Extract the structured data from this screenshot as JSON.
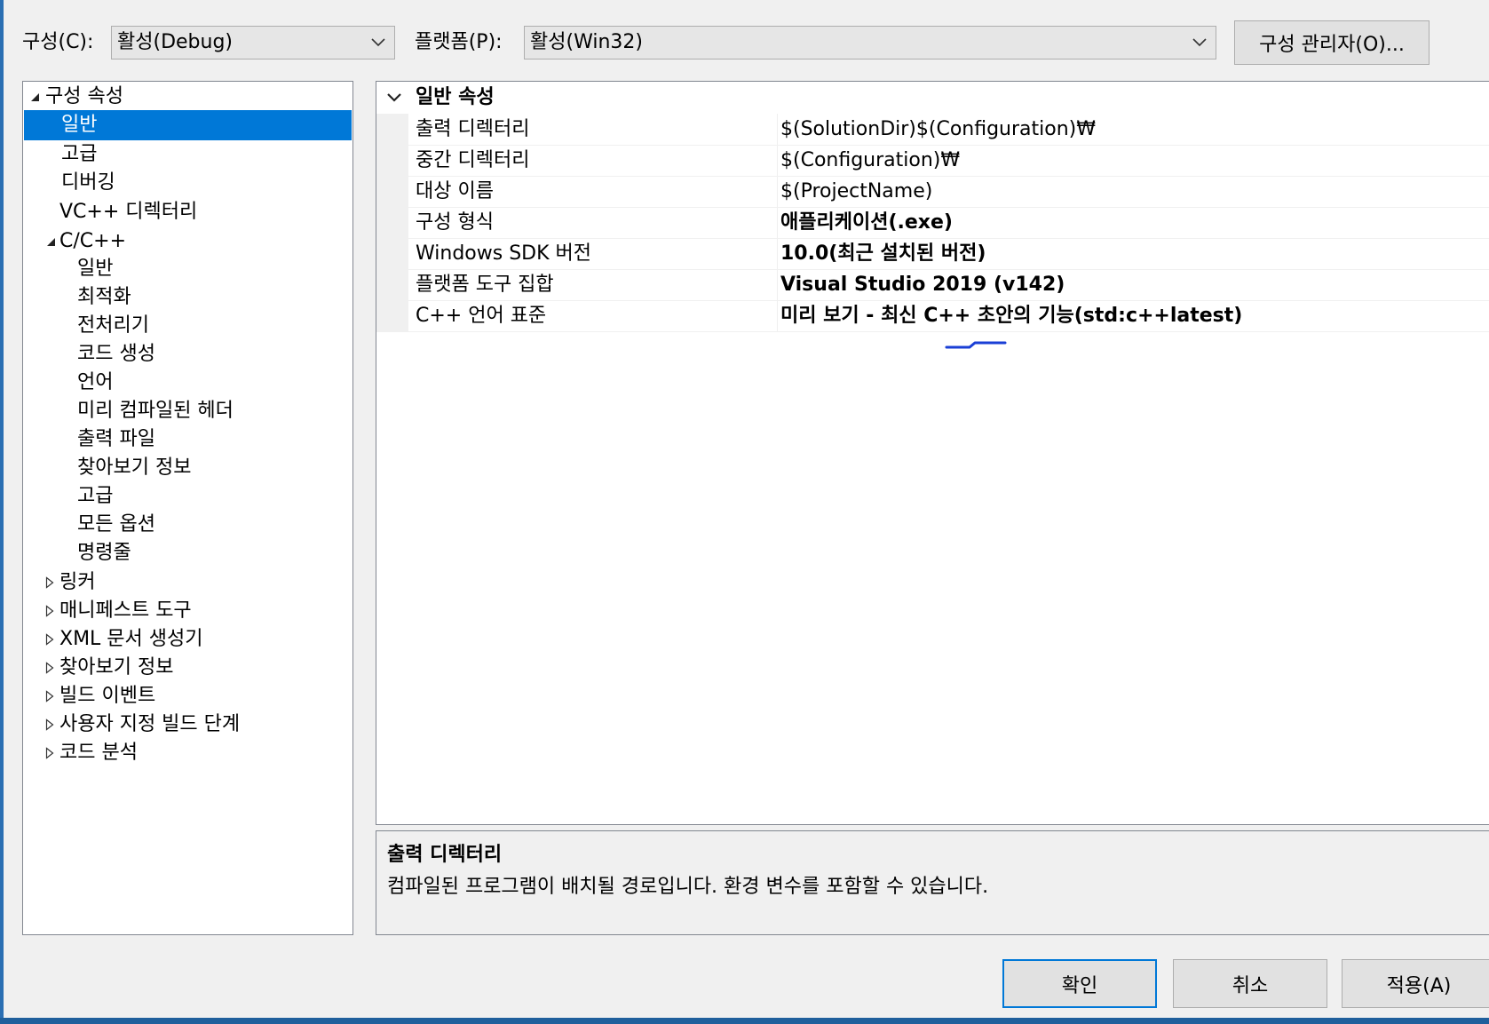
{
  "toolbar": {
    "config_label": "구성(C):",
    "config_value": "활성(Debug)",
    "platform_label": "플랫폼(P):",
    "platform_value": "활성(Win32)",
    "config_manager_button": "구성 관리자(O)..."
  },
  "tree": {
    "root": "구성 속성",
    "items": [
      {
        "label": "일반",
        "selected": true
      },
      {
        "label": "고급"
      },
      {
        "label": "디버깅"
      },
      {
        "label": "VC++ 디렉터리"
      }
    ],
    "cpp": {
      "label": "C/C++",
      "children": [
        "일반",
        "최적화",
        "전처리기",
        "코드 생성",
        "언어",
        "미리 컴파일된 헤더",
        "출력 파일",
        "찾아보기 정보",
        "고급",
        "모든 옵션",
        "명령줄"
      ]
    },
    "collapsed": [
      "링커",
      "매니페스트 도구",
      "XML 문서 생성기",
      "찾아보기 정보",
      "빌드 이벤트",
      "사용자 지정 빌드 단계",
      "코드 분석"
    ]
  },
  "grid": {
    "category": "일반 속성",
    "rows": [
      {
        "name": "출력 디렉터리",
        "value": "$(SolutionDir)$(Configuration)₩",
        "bold": false
      },
      {
        "name": "중간 디렉터리",
        "value": "$(Configuration)₩",
        "bold": false
      },
      {
        "name": "대상 이름",
        "value": "$(ProjectName)",
        "bold": false
      },
      {
        "name": "구성 형식",
        "value": "애플리케이션(.exe)",
        "bold": true
      },
      {
        "name": "Windows SDK 버전",
        "value": "10.0(최근 설치된 버전)",
        "bold": true
      },
      {
        "name": "플랫폼 도구 집합",
        "value": "Visual Studio 2019 (v142)",
        "bold": true
      },
      {
        "name": "C++ 언어 표준",
        "value": "미리 보기 - 최신 C++ 초안의 기능(std:c++latest)",
        "bold": true
      }
    ]
  },
  "description": {
    "title": "출력 디렉터리",
    "text": "컴파일된 프로그램이 배치될 경로입니다. 환경 변수를 포함할 수 있습니다."
  },
  "buttons": {
    "ok": "확인",
    "cancel": "취소",
    "apply": "적용(A)"
  },
  "colors": {
    "selection": "#0078d7",
    "annotation": "#1a3fd6"
  },
  "icons": {
    "expanded": "expanded-triangle-icon",
    "collapsed": "collapsed-triangle-icon",
    "dropdown": "chevron-down-icon"
  }
}
